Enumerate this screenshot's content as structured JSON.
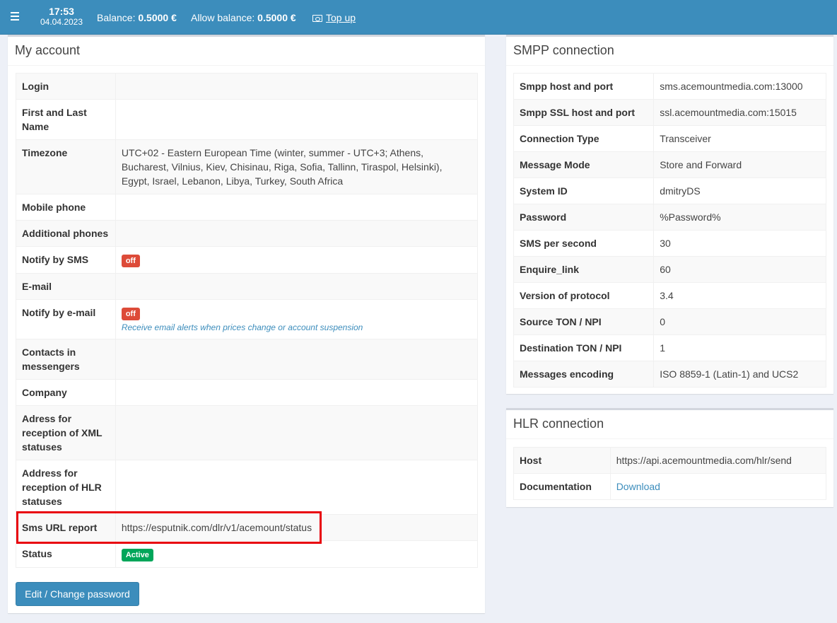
{
  "header": {
    "time": "17:53",
    "date": "04.04.2023",
    "balance_label": "Balance:",
    "balance_value": "0.5000 €",
    "allow_balance_label": "Allow balance:",
    "allow_balance_value": "0.5000 €",
    "topup_label": "Top up"
  },
  "account": {
    "title": "My account",
    "rows": {
      "login": "Login",
      "name": "First and Last Name",
      "timezone": "Timezone",
      "timezone_value": "UTC+02 - Eastern European Time (winter, summer - UTC+3; Athens, Bucharest, Vilnius, Kiev, Chisinau, Riga, Sofia, Tallinn, Tiraspol, Helsinki), Egypt, Israel, Lebanon, Libya, Turkey, South Africa",
      "mobile": "Mobile phone",
      "additional": "Additional phones",
      "notify_sms": "Notify by SMS",
      "notify_sms_badge": "off",
      "email": "E-mail",
      "notify_email": "Notify by e-mail",
      "notify_email_badge": "off",
      "notify_email_hint": "Receive email alerts when prices change or account suspension",
      "messengers": "Contacts in messengers",
      "company": "Company",
      "xml": "Adress for reception of XML statuses",
      "hlr": "Address for reception of HLR statuses",
      "sms_url": "Sms URL report",
      "sms_url_value": "https://esputnik.com/dlr/v1/acemount/status",
      "status": "Status",
      "status_badge": "Active"
    },
    "edit_button": "Edit / Change password"
  },
  "smpp": {
    "title": "SMPP connection",
    "rows": [
      {
        "k": "Smpp host and port",
        "v": "sms.acemountmedia.com:13000"
      },
      {
        "k": "Smpp SSL host and port",
        "v": "ssl.acemountmedia.com:15015"
      },
      {
        "k": "Connection Type",
        "v": "Transceiver"
      },
      {
        "k": "Message Mode",
        "v": "Store and Forward"
      },
      {
        "k": "System ID",
        "v": "dmitryDS"
      },
      {
        "k": "Password",
        "v": "%Password%"
      },
      {
        "k": "SMS per second",
        "v": "30"
      },
      {
        "k": "Enquire_link",
        "v": "60"
      },
      {
        "k": "Version of protocol",
        "v": "3.4"
      },
      {
        "k": "Source TON / NPI",
        "v": "0"
      },
      {
        "k": "Destination TON / NPI",
        "v": "1"
      },
      {
        "k": "Messages encoding",
        "v": "ISO 8859-1 (Latin-1) and UCS2"
      }
    ]
  },
  "hlr": {
    "title": "HLR connection",
    "host_label": "Host",
    "host_value": "https://api.acemountmedia.com/hlr/send",
    "doc_label": "Documentation",
    "doc_value": "Download"
  },
  "colors": {
    "header": "#3c8dbc",
    "badge_off": "#dd4b39",
    "badge_active": "#00a65a",
    "highlight": "#e8000b"
  }
}
